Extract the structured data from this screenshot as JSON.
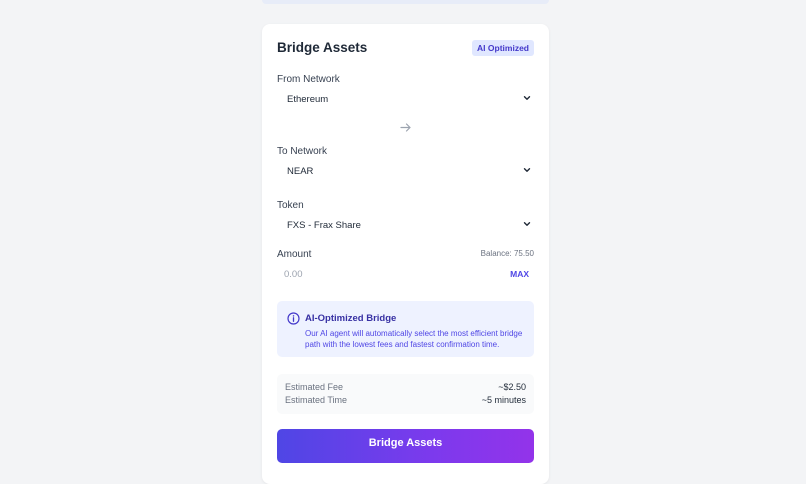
{
  "card": {
    "title": "Bridge Assets",
    "badge": "AI Optimized"
  },
  "from_network": {
    "label": "From Network",
    "selected": "Ethereum"
  },
  "to_network": {
    "label": "To Network",
    "selected": "NEAR"
  },
  "token": {
    "label": "Token",
    "selected": "FXS - Frax Share"
  },
  "amount": {
    "label": "Amount",
    "balance": "Balance: 75.50",
    "placeholder": "0.00",
    "value": "",
    "max_label": "MAX"
  },
  "info": {
    "title": "AI-Optimized Bridge",
    "text": "Our AI agent will automatically select the most efficient bridge path with the lowest fees and fastest confirmation time."
  },
  "estimates": {
    "fee_label": "Estimated Fee",
    "fee_value": "~$2.50",
    "time_label": "Estimated Time",
    "time_value": "~5 minutes"
  },
  "submit_label": "Bridge Assets",
  "icons": {
    "chevron": "chevron-down-icon",
    "swap": "arrow-right-icon",
    "info": "info-circle-icon"
  },
  "colors": {
    "accent": "#4f46e5",
    "accent_end": "#9333ea",
    "info_bg": "#eef2ff"
  }
}
